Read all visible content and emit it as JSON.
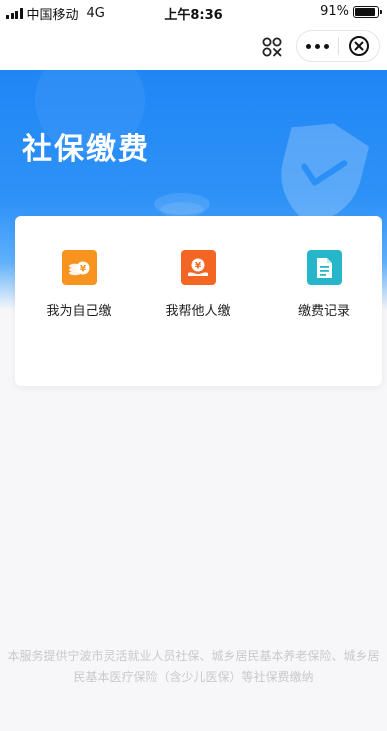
{
  "status_bar": {
    "carrier": "中国移动",
    "network": "4G",
    "time": "上午8:36",
    "battery": "91%",
    "battery_level": 0.91
  },
  "nav": {
    "scan_icon": "scan-icon",
    "more_icon": "more-icon",
    "close_icon": "close-icon"
  },
  "banner": {
    "title": "社保缴费"
  },
  "services": [
    {
      "label": "我为自己缴",
      "icon": "coins-icon",
      "color": "#f7931e"
    },
    {
      "label": "我帮他人缴",
      "icon": "hand-money-icon",
      "color": "#f26522"
    },
    {
      "label": "缴费记录",
      "icon": "document-icon",
      "color": "#26b5c9"
    }
  ],
  "footer": {
    "note": "本服务提供宁波市灵活就业人员社保、城乡居民基本养老保险、城乡居民基本医疗保险（含少儿医保）等社保费缴纳"
  }
}
